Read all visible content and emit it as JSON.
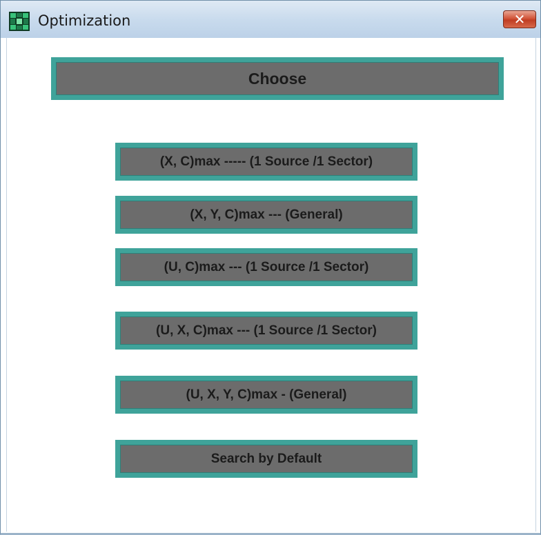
{
  "window": {
    "title": "Optimization",
    "close_label": "✕",
    "icon": "app-grid-icon"
  },
  "main": {
    "choose_label": "Choose",
    "options": [
      "(X, C)max ----- (1 Source /1 Sector)",
      "(X, Y, C)max --- (General)",
      "(U, C)max --- (1 Source /1 Sector)",
      "(U, X, C)max --- (1 Source /1 Sector)",
      "(U, X, Y, C)max - (General)",
      "Search by Default"
    ]
  },
  "colors": {
    "button_fill": "#6c6c6c",
    "button_border": "#3fa39a",
    "close_button": "#c9472c",
    "titlebar": "#c9dbed"
  }
}
